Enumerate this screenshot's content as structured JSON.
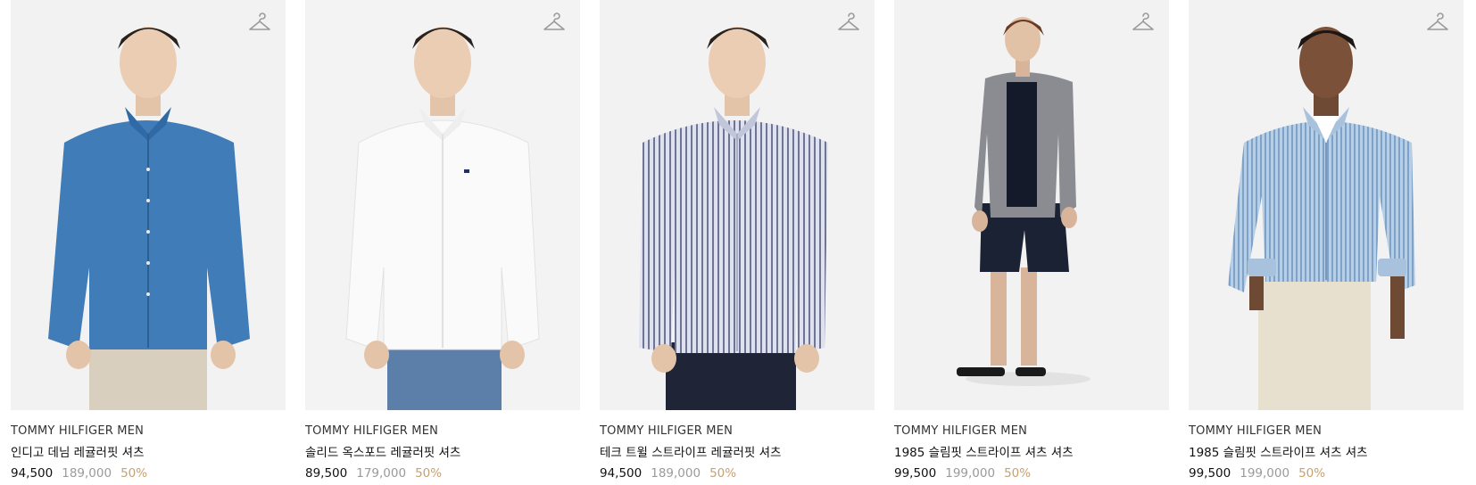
{
  "accent_colors": {
    "discount": "#c9a06e",
    "original_price": "#9a9a9a",
    "text": "#111111",
    "thumb_bg": "#f2f2f2"
  },
  "products": [
    {
      "brand": "TOMMY HILFIGER MEN",
      "name": "인디고 데님 레귤러핏 셔츠",
      "price": "94,500",
      "original_price": "189,000",
      "discount": "50%",
      "icon": "hanger-icon",
      "shirt_color": "#3f7cb8",
      "pants_color": "#d9cfbf",
      "pattern": "solid"
    },
    {
      "brand": "TOMMY HILFIGER MEN",
      "name": "솔리드 옥스포드 레귤러핏 셔츠",
      "price": "89,500",
      "original_price": "179,000",
      "discount": "50%",
      "icon": "hanger-icon",
      "shirt_color": "#f7f7f7",
      "pants_color": "#5b7fa8",
      "pattern": "solid"
    },
    {
      "brand": "TOMMY HILFIGER MEN",
      "name": "테크 트윌 스트라이프 레귤러핏 셔츠",
      "price": "94,500",
      "original_price": "189,000",
      "discount": "50%",
      "icon": "hanger-icon",
      "shirt_color": "#c7cbe0",
      "pants_color": "#1f2536",
      "pattern": "stripe"
    },
    {
      "brand": "TOMMY HILFIGER MEN",
      "name": "1985 슬림핏 스트라이프 셔츠 셔츠",
      "price": "99,500",
      "original_price": "199,000",
      "discount": "50%",
      "icon": "hanger-icon",
      "shirt_color": "#8a8c92",
      "pants_color": "#1a2233",
      "pattern": "full-body"
    },
    {
      "brand": "TOMMY HILFIGER MEN",
      "name": "1985 슬림핏 스트라이프 셔츠 셔츠",
      "price": "99,500",
      "original_price": "199,000",
      "discount": "50%",
      "icon": "hanger-icon",
      "shirt_color": "#9fbedb",
      "pants_color": "#e7e0cf",
      "pattern": "stripe"
    }
  ]
}
